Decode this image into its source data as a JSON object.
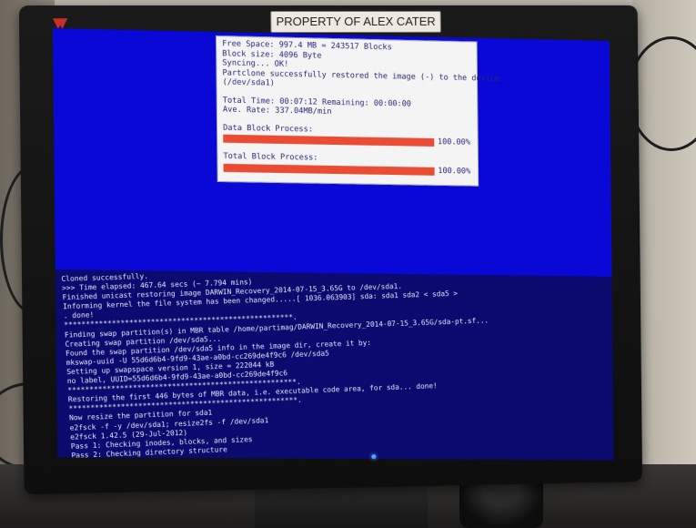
{
  "monitor": {
    "property_label": "PROPERTY OF ALEX CATER"
  },
  "dialog": {
    "lines": [
      "Free Space:   997.4 MB = 243517 Blocks",
      "Block size:   4096 Byte",
      "Syncing... OK!",
      "Partclone successfully restored the image (-) to the device",
      "(/dev/sda1)"
    ],
    "timing": [
      "Total Time: 00:07:12 Remaining: 00:00:00",
      "Ave. Rate: 337.04MB/min"
    ],
    "data_block_label": "Data Block Process:",
    "data_block_percent_text": "100.00%",
    "data_block_fraction": 1.0,
    "total_block_label": "Total Block Process:",
    "total_block_percent_text": "100.00%",
    "total_block_fraction": 1.0,
    "bar_color": "#ea4b35"
  },
  "terminal": {
    "lines": [
      "Cloned successfully.",
      ">>> Time elapsed: 467.64 secs (~ 7.794 mins)",
      "Finished unicast restoring image DARWIN_Recovery_2014-07-15_3.65G to /dev/sda1.",
      "Informing kernel the file system has been changed.....[ 1036.063903]  sda: sda1 sda2 < sda5 >",
      ". done!",
      "*****************************************************.",
      "Finding swap partition(s) in MBR table /home/partimag/DARWIN_Recovery_2014-07-15_3.65G/sda-pt.sf...",
      "Creating swap partition /dev/sda5...",
      "Found the swap partition /dev/sda5 info in the image dir, create it by:",
      "mkswap-uuid  -U 55d6d6b4-9fd9-43ae-a0bd-cc269de4f9c6 /dev/sda5",
      "Setting up swapspace version 1, size = 222044 kB",
      "no label, UUID=55d6d6b4-9fd9-43ae-a0bd-cc269de4f9c6",
      "*****************************************************.",
      "Restoring the first 446 bytes of MBR data, i.e. executable code area, for sda... done!",
      "*****************************************************.",
      "Now resize the partition for sda1",
      "e2fsck -f -y /dev/sda1; resize2fs -f /dev/sda1",
      "e2fsck 1.42.5 (29-Jul-2012)",
      "Pass 1: Checking inodes, blocks, and sizes",
      "Pass 2: Checking directory structure"
    ]
  },
  "icons": {
    "brand": "brand-logo-icon",
    "power_led": "power-led-icon",
    "cursor": "cursor-icon"
  },
  "colors": {
    "screen_blue": "#0a08d6",
    "terminal_bg": "#0b0a6e",
    "dialog_text": "#2a2a7a"
  }
}
